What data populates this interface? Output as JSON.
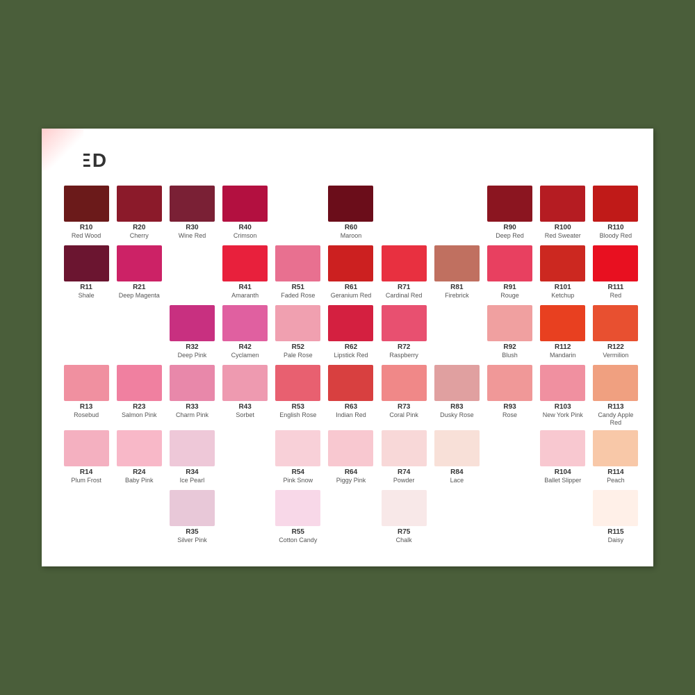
{
  "title": "RED",
  "colors": [
    {
      "code": "R10",
      "name": "Red Wood",
      "hex": "#6B1A1A",
      "row": 1,
      "col": 1
    },
    {
      "code": "R20",
      "name": "Cherry",
      "hex": "#8B1A2A",
      "row": 1,
      "col": 2
    },
    {
      "code": "R30",
      "name": "Wine Red",
      "hex": "#7A2035",
      "row": 1,
      "col": 3
    },
    {
      "code": "R40",
      "name": "Crimson",
      "hex": "#B31040",
      "row": 1,
      "col": 4
    },
    {
      "code": "R60",
      "name": "Maroon",
      "hex": "#6B0D1A",
      "row": 1,
      "col": 6
    },
    {
      "code": "R90",
      "name": "Deep Red",
      "hex": "#8B1520",
      "row": 1,
      "col": 9
    },
    {
      "code": "R100",
      "name": "Red Sweater",
      "hex": "#B51C22",
      "row": 1,
      "col": 10
    },
    {
      "code": "R110",
      "name": "Bloody Red",
      "hex": "#C01A18",
      "row": 1,
      "col": 11
    },
    {
      "code": "R11",
      "name": "Shale",
      "hex": "#6B1530",
      "row": 2,
      "col": 1
    },
    {
      "code": "R21",
      "name": "Deep Magenta",
      "hex": "#CC2266",
      "row": 2,
      "col": 2
    },
    {
      "code": "R41",
      "name": "Amaranth",
      "hex": "#E8203C",
      "row": 2,
      "col": 4
    },
    {
      "code": "R51",
      "name": "Faded Rose",
      "hex": "#E87090",
      "row": 2,
      "col": 5
    },
    {
      "code": "R61",
      "name": "Geranium Red",
      "hex": "#CC2020",
      "row": 2,
      "col": 6
    },
    {
      "code": "R71",
      "name": "Cardinal Red",
      "hex": "#E83040",
      "row": 2,
      "col": 7
    },
    {
      "code": "R81",
      "name": "Firebrick",
      "hex": "#C07060",
      "row": 2,
      "col": 8
    },
    {
      "code": "R91",
      "name": "Rouge",
      "hex": "#E84060",
      "row": 2,
      "col": 9
    },
    {
      "code": "R101",
      "name": "Ketchup",
      "hex": "#CC2820",
      "row": 2,
      "col": 10
    },
    {
      "code": "R111",
      "name": "Red",
      "hex": "#E81020",
      "row": 2,
      "col": 11
    },
    {
      "code": "R32",
      "name": "Deep Pink",
      "hex": "#C83080",
      "row": 3,
      "col": 3
    },
    {
      "code": "R42",
      "name": "Cyclamen",
      "hex": "#E060A0",
      "row": 3,
      "col": 4
    },
    {
      "code": "R52",
      "name": "Pale Rose",
      "hex": "#F0A0B0",
      "row": 3,
      "col": 5
    },
    {
      "code": "R62",
      "name": "Lipstick Red",
      "hex": "#D42040",
      "row": 3,
      "col": 6
    },
    {
      "code": "R72",
      "name": "Raspberry",
      "hex": "#E85070",
      "row": 3,
      "col": 7
    },
    {
      "code": "R92",
      "name": "Blush",
      "hex": "#F0A0A0",
      "row": 3,
      "col": 9
    },
    {
      "code": "R112",
      "name": "Mandarin",
      "hex": "#E84020",
      "row": 3,
      "col": 10
    },
    {
      "code": "R122",
      "name": "Vermilion",
      "hex": "#E85030",
      "row": 3,
      "col": 11
    },
    {
      "code": "R13",
      "name": "Rosebud",
      "hex": "#F090A0",
      "row": 4,
      "col": 1
    },
    {
      "code": "R23",
      "name": "Salmon Pink",
      "hex": "#F080A0",
      "row": 4,
      "col": 2
    },
    {
      "code": "R33",
      "name": "Charm Pink",
      "hex": "#E888AA",
      "row": 4,
      "col": 3
    },
    {
      "code": "R43",
      "name": "Sorbet",
      "hex": "#EE9AB0",
      "row": 4,
      "col": 4
    },
    {
      "code": "R53",
      "name": "English Rose",
      "hex": "#E86070",
      "row": 4,
      "col": 5
    },
    {
      "code": "R63",
      "name": "Indian Red",
      "hex": "#D84040",
      "row": 4,
      "col": 6
    },
    {
      "code": "R73",
      "name": "Coral Pink",
      "hex": "#F08888",
      "row": 4,
      "col": 7
    },
    {
      "code": "R83",
      "name": "Dusky Rose",
      "hex": "#E0A0A0",
      "row": 4,
      "col": 8
    },
    {
      "code": "R93",
      "name": "Rose",
      "hex": "#F09898",
      "row": 4,
      "col": 9
    },
    {
      "code": "R103",
      "name": "New York Pink",
      "hex": "#F090A0",
      "row": 4,
      "col": 10
    },
    {
      "code": "R113",
      "name": "Candy Apple Red",
      "hex": "#F0A080",
      "row": 4,
      "col": 11
    },
    {
      "code": "R14",
      "name": "Plum Frost",
      "hex": "#F4B0C0",
      "row": 5,
      "col": 1
    },
    {
      "code": "R24",
      "name": "Baby Pink",
      "hex": "#F8B8C8",
      "row": 5,
      "col": 2
    },
    {
      "code": "R34",
      "name": "Ice Pearl",
      "hex": "#EEC8D8",
      "row": 5,
      "col": 3
    },
    {
      "code": "R54",
      "name": "Pink Snow",
      "hex": "#F8D0D8",
      "row": 5,
      "col": 5
    },
    {
      "code": "R64",
      "name": "Piggy Pink",
      "hex": "#F8C8D0",
      "row": 5,
      "col": 6
    },
    {
      "code": "R74",
      "name": "Powder",
      "hex": "#F8D8D8",
      "row": 5,
      "col": 7
    },
    {
      "code": "R84",
      "name": "Lace",
      "hex": "#F8E0D8",
      "row": 5,
      "col": 8
    },
    {
      "code": "R104",
      "name": "Ballet Slipper",
      "hex": "#F8C8D0",
      "row": 5,
      "col": 10
    },
    {
      "code": "R114",
      "name": "Peach",
      "hex": "#F8C8A8",
      "row": 5,
      "col": 11
    },
    {
      "code": "R35",
      "name": "Silver Pink",
      "hex": "#E8C8D8",
      "row": 6,
      "col": 3
    },
    {
      "code": "R55",
      "name": "Cotton Candy",
      "hex": "#F8D8E8",
      "row": 6,
      "col": 5
    },
    {
      "code": "R75",
      "name": "Chalk",
      "hex": "#F8E8E8",
      "row": 6,
      "col": 7
    },
    {
      "code": "R115",
      "name": "Daisy",
      "hex": "#FFF0E8",
      "row": 6,
      "col": 11
    }
  ]
}
